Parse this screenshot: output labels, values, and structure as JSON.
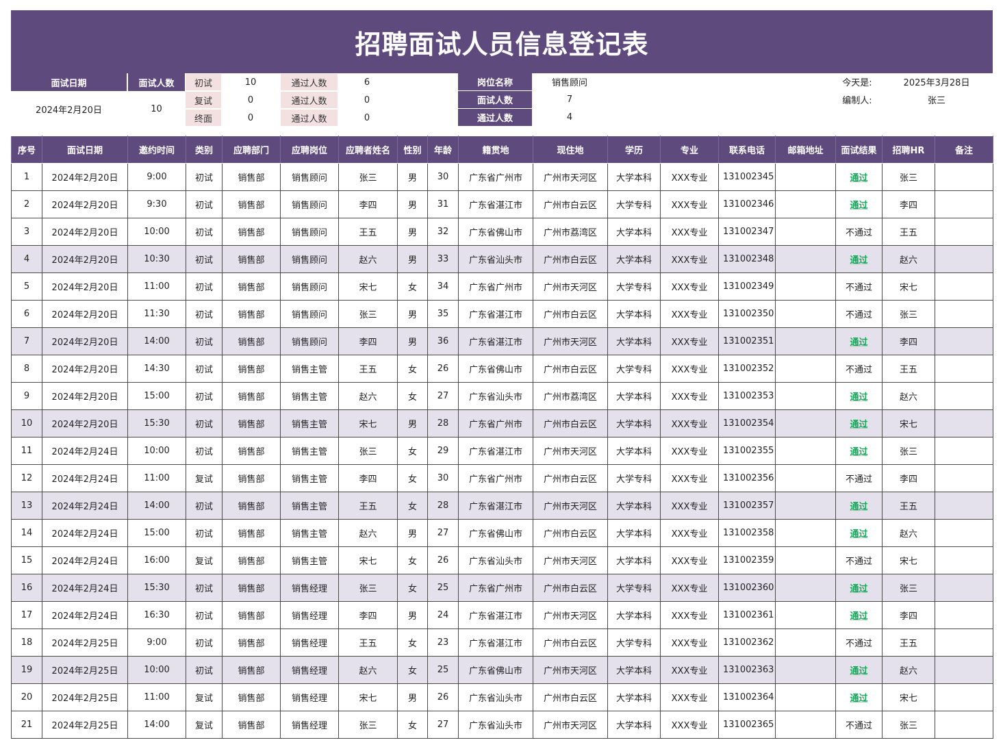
{
  "title": "招聘面试人员信息登记表",
  "colors": {
    "header": "#5e4a7c",
    "alt_row": "#e4e1ec",
    "pink": "#f3e0e1",
    "pass": "#18a55a"
  },
  "summary": {
    "date_label": "面试日期",
    "date_value": "2024年2月20日",
    "count_label": "面试人数",
    "count_value": "10",
    "rounds": [
      {
        "name": "初试",
        "count": "10",
        "pass_label": "通过人数",
        "pass": "6"
      },
      {
        "name": "复试",
        "count": "0",
        "pass_label": "通过人数",
        "pass": "0"
      },
      {
        "name": "终面",
        "count": "0",
        "pass_label": "通过人数",
        "pass": "0"
      }
    ],
    "position_label": "岗位名称",
    "position_value": "销售顾问",
    "pos_count_label": "面试人数",
    "pos_count_value": "7",
    "pos_pass_label": "通过人数",
    "pos_pass_value": "4",
    "today_label": "今天是:",
    "today_value": "2025年3月28日",
    "editor_label": "编制人:",
    "editor_value": "张三"
  },
  "table": {
    "headers": [
      "序号",
      "面试日期",
      "邀约时间",
      "类别",
      "应聘部门",
      "应聘岗位",
      "应聘者姓名",
      "性别",
      "年龄",
      "籍贯地",
      "现住地",
      "学历",
      "专业",
      "联系电话",
      "邮箱地址",
      "面试结果",
      "招聘HR",
      "备注"
    ],
    "rows": [
      [
        "1",
        "2024年2月20日",
        "9:00",
        "初试",
        "销售部",
        "销售顾问",
        "张三",
        "男",
        "30",
        "广东省广州市",
        "广州市天河区",
        "大学本科",
        "XXX专业",
        "131002345",
        "",
        "通过",
        "张三",
        ""
      ],
      [
        "2",
        "2024年2月20日",
        "9:30",
        "初试",
        "销售部",
        "销售顾问",
        "李四",
        "男",
        "31",
        "广东省湛江市",
        "广州市白云区",
        "大学专科",
        "XXX专业",
        "131002346",
        "",
        "通过",
        "李四",
        ""
      ],
      [
        "3",
        "2024年2月20日",
        "10:00",
        "初试",
        "销售部",
        "销售顾问",
        "王五",
        "男",
        "32",
        "广东省佛山市",
        "广州市荔湾区",
        "大学本科",
        "XXX专业",
        "131002347",
        "",
        "不通过",
        "王五",
        ""
      ],
      [
        "4",
        "2024年2月20日",
        "10:30",
        "初试",
        "销售部",
        "销售顾问",
        "赵六",
        "男",
        "33",
        "广东省汕头市",
        "广州市白云区",
        "大学本科",
        "XXX专业",
        "131002348",
        "",
        "通过",
        "赵六",
        ""
      ],
      [
        "5",
        "2024年2月20日",
        "11:00",
        "初试",
        "销售部",
        "销售顾问",
        "宋七",
        "女",
        "34",
        "广东省广州市",
        "广州市天河区",
        "大学专科",
        "XXX专业",
        "131002349",
        "",
        "不通过",
        "宋七",
        ""
      ],
      [
        "6",
        "2024年2月20日",
        "11:30",
        "初试",
        "销售部",
        "销售顾问",
        "张三",
        "男",
        "35",
        "广东省湛江市",
        "广州市白云区",
        "大学本科",
        "XXX专业",
        "131002350",
        "",
        "不通过",
        "张三",
        ""
      ],
      [
        "7",
        "2024年2月20日",
        "14:00",
        "初试",
        "销售部",
        "销售顾问",
        "李四",
        "男",
        "36",
        "广东省湛江市",
        "广州市天河区",
        "大学本科",
        "XXX专业",
        "131002351",
        "",
        "通过",
        "李四",
        ""
      ],
      [
        "8",
        "2024年2月20日",
        "14:30",
        "初试",
        "销售部",
        "销售主管",
        "王五",
        "女",
        "26",
        "广东省佛山市",
        "广州市白云区",
        "大学专科",
        "XXX专业",
        "131002352",
        "",
        "不通过",
        "王五",
        ""
      ],
      [
        "9",
        "2024年2月20日",
        "15:00",
        "初试",
        "销售部",
        "销售主管",
        "赵六",
        "女",
        "27",
        "广东省汕头市",
        "广州市荔湾区",
        "大学本科",
        "XXX专业",
        "131002353",
        "",
        "通过",
        "赵六",
        ""
      ],
      [
        "10",
        "2024年2月20日",
        "15:30",
        "初试",
        "销售部",
        "销售主管",
        "宋七",
        "男",
        "28",
        "广东省广州市",
        "广州市白云区",
        "大学本科",
        "XXX专业",
        "131002354",
        "",
        "通过",
        "宋七",
        ""
      ],
      [
        "11",
        "2024年2月24日",
        "10:00",
        "初试",
        "销售部",
        "销售主管",
        "张三",
        "女",
        "29",
        "广东省湛江市",
        "广州市天河区",
        "大学本科",
        "XXX专业",
        "131002355",
        "",
        "通过",
        "张三",
        ""
      ],
      [
        "12",
        "2024年2月24日",
        "11:00",
        "复试",
        "销售部",
        "销售主管",
        "李四",
        "女",
        "30",
        "广东省广州市",
        "广州市白云区",
        "大学专科",
        "XXX专业",
        "131002356",
        "",
        "不通过",
        "李四",
        ""
      ],
      [
        "13",
        "2024年2月24日",
        "14:00",
        "初试",
        "销售部",
        "销售主管",
        "王五",
        "女",
        "28",
        "广东省湛江市",
        "广州市天河区",
        "大学本科",
        "XXX专业",
        "131002357",
        "",
        "通过",
        "王五",
        ""
      ],
      [
        "14",
        "2024年2月24日",
        "15:00",
        "初试",
        "销售部",
        "销售主管",
        "赵六",
        "男",
        "27",
        "广东省佛山市",
        "广州市白云区",
        "大学本科",
        "XXX专业",
        "131002358",
        "",
        "通过",
        "赵六",
        ""
      ],
      [
        "15",
        "2024年2月24日",
        "16:00",
        "复试",
        "销售部",
        "销售主管",
        "宋七",
        "女",
        "26",
        "广东省汕头市",
        "广州市天河区",
        "大学本科",
        "XXX专业",
        "131002359",
        "",
        "不通过",
        "宋七",
        ""
      ],
      [
        "16",
        "2024年2月24日",
        "15:30",
        "初试",
        "销售部",
        "销售经理",
        "张三",
        "女",
        "25",
        "广东省广州市",
        "广州市白云区",
        "大学专科",
        "XXX专业",
        "131002360",
        "",
        "通过",
        "张三",
        ""
      ],
      [
        "17",
        "2024年2月24日",
        "16:30",
        "初试",
        "销售部",
        "销售经理",
        "李四",
        "男",
        "24",
        "广东省湛江市",
        "广州市天河区",
        "大学本科",
        "XXX专业",
        "131002361",
        "",
        "通过",
        "李四",
        ""
      ],
      [
        "18",
        "2024年2月25日",
        "9:00",
        "初试",
        "销售部",
        "销售经理",
        "王五",
        "女",
        "23",
        "广东省湛江市",
        "广州市白云区",
        "大学专科",
        "XXX专业",
        "131002362",
        "",
        "不通过",
        "王五",
        ""
      ],
      [
        "19",
        "2024年2月25日",
        "10:00",
        "初试",
        "销售部",
        "销售经理",
        "赵六",
        "女",
        "25",
        "广东省佛山市",
        "广州市天河区",
        "大学本科",
        "XXX专业",
        "131002363",
        "",
        "通过",
        "赵六",
        ""
      ],
      [
        "20",
        "2024年2月25日",
        "11:00",
        "复试",
        "销售部",
        "销售经理",
        "宋七",
        "男",
        "26",
        "广东省汕头市",
        "广州市白云区",
        "大学本科",
        "XXX专业",
        "131002364",
        "",
        "通过",
        "宋七",
        ""
      ],
      [
        "21",
        "2024年2月25日",
        "14:00",
        "复试",
        "销售部",
        "销售经理",
        "张三",
        "女",
        "27",
        "广东省汕头市",
        "广州市天河区",
        "大学本科",
        "XXX专业",
        "131002365",
        "",
        "不通过",
        "张三",
        ""
      ]
    ],
    "alt_rows": [
      4,
      7,
      10,
      13,
      16,
      19
    ]
  }
}
